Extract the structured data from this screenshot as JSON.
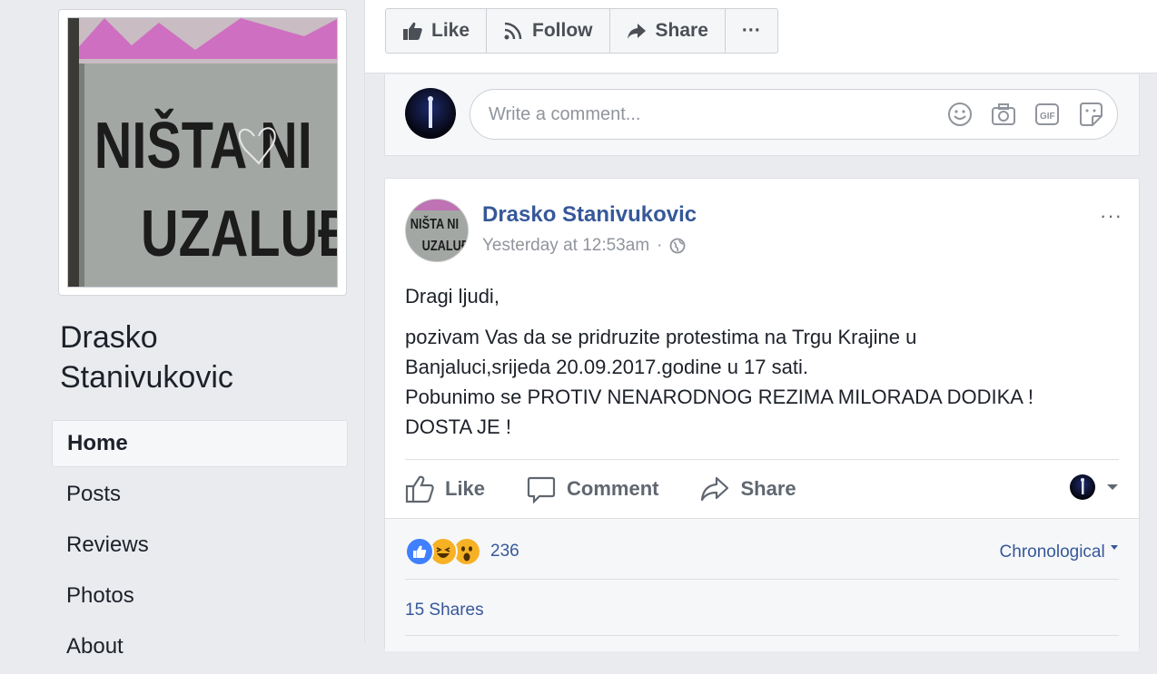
{
  "sidebar": {
    "page_name": "Drasko Stanivukovic",
    "profile_pic_text": {
      "line1": "NIŠTA NI",
      "line2": "UZALUĐ"
    },
    "nav": [
      {
        "label": "Home",
        "active": true
      },
      {
        "label": "Posts"
      },
      {
        "label": "Reviews"
      },
      {
        "label": "Photos"
      },
      {
        "label": "About"
      }
    ]
  },
  "page_actions": {
    "like": "Like",
    "follow": "Follow",
    "share": "Share",
    "more": "···"
  },
  "comment_box": {
    "placeholder": "Write a comment..."
  },
  "post": {
    "author": "Drasko Stanivukovic",
    "timestamp": "Yesterday at 12:53am",
    "timestamp_sep": "·",
    "menu": "···",
    "body": {
      "p1": "Dragi ljudi,",
      "p2_l1": "pozivam Vas da se pridruzite protestima na Trgu Krajine u",
      "p2_l2": "Banjaluci,srijeda 20.09.2017.godine u 17 sati.",
      "p2_l3": "Pobunimo se PROTIV NENARODNOG REZIMA MILORADA DODIKA !",
      "p2_l4": "DOSTA JE !"
    },
    "actions": {
      "like": "Like",
      "comment": "Comment",
      "share": "Share"
    },
    "reactions_count": "236",
    "order": "Chronological",
    "shares": "15 Shares"
  },
  "colors": {
    "link": "#365899",
    "like_blue": "#4080ff",
    "haha_yellow": "#f7b125",
    "bg": "#e9ebee"
  }
}
